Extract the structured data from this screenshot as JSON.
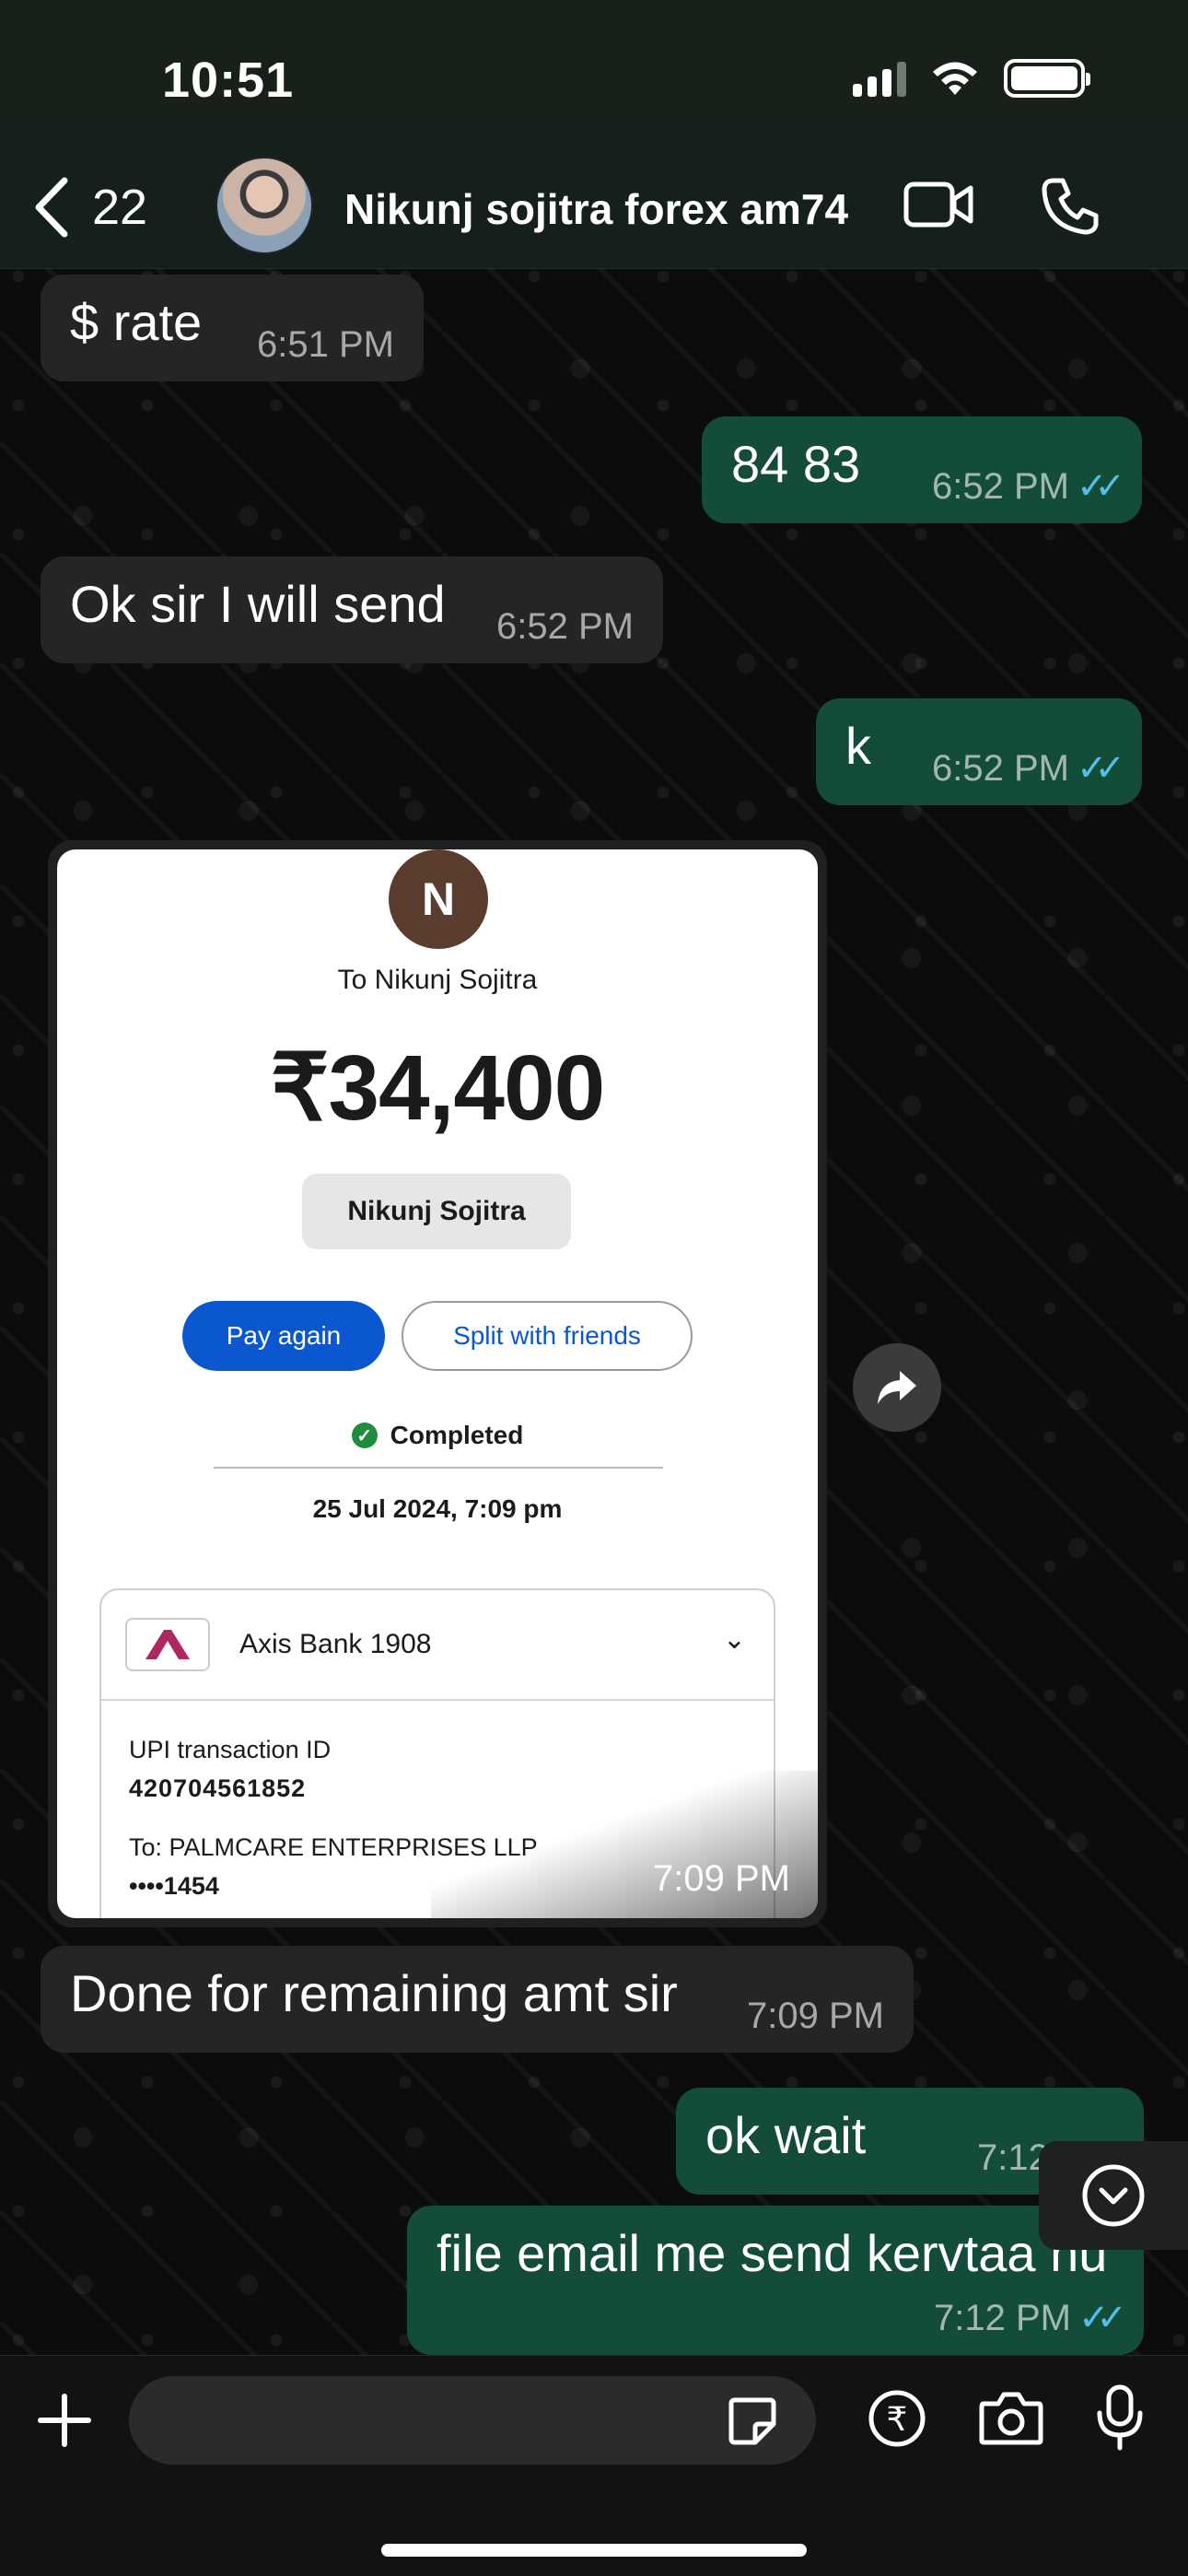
{
  "status_bar": {
    "time": "10:51"
  },
  "header": {
    "back_count": "22",
    "contact_name": "Nikunj sojitra forex am74",
    "icons": [
      "back-chevron-icon",
      "video-call-icon",
      "phone-call-icon"
    ]
  },
  "messages": [
    {
      "dir": "in",
      "text": "$ rate",
      "time": "6:51 PM"
    },
    {
      "dir": "out",
      "text": "84 83",
      "time": "6:52 PM",
      "read": true
    },
    {
      "dir": "in",
      "text": "Ok sir I will send",
      "time": "6:52 PM"
    },
    {
      "dir": "out",
      "text": "k",
      "time": "6:52 PM",
      "read": true
    },
    {
      "dir": "in",
      "type": "image",
      "time": "7:09 PM"
    },
    {
      "dir": "in",
      "text": "Done for remaining amt sir",
      "time": "7:09 PM"
    },
    {
      "dir": "out",
      "text": "ok wait",
      "time": "7:12 PM"
    },
    {
      "dir": "out",
      "text": "file email me send kervtaa nu",
      "time": "7:12 PM",
      "read": true
    }
  ],
  "receipt": {
    "avatar_letter": "N",
    "to_line": "To Nikunj Sojitra",
    "amount": "₹34,400",
    "name_pill": "Nikunj Sojitra",
    "pay_again": "Pay again",
    "split": "Split with friends",
    "status": "Completed",
    "date": "25 Jul 2024, 7:09 pm",
    "bank": "Axis Bank 1908",
    "upi_label": "UPI transaction ID",
    "upi_id": "420704561852",
    "to_label": "To: PALMCARE ENTERPRISES LLP",
    "account": "••••1454"
  },
  "colors": {
    "incoming_bubble": "#242626",
    "outgoing_bubble": "#144d37",
    "read_ticks": "#53bdeb",
    "pay_button": "#0b57d0"
  }
}
